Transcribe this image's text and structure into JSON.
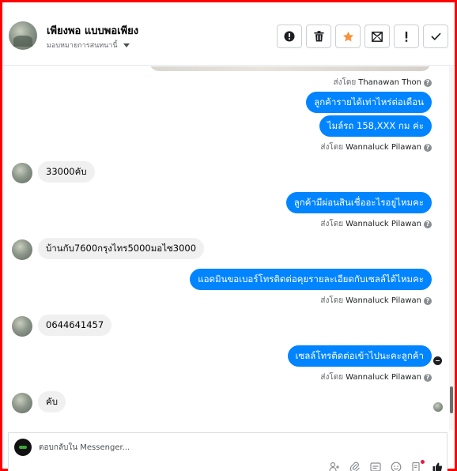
{
  "header": {
    "contact_name": "เพียงพอ แบบพอเพียง",
    "assign_label": "มอบหมายการสนทนานี้",
    "actions": [
      {
        "name": "spam-button",
        "icon": "exclamation-circle-icon"
      },
      {
        "name": "delete-button",
        "icon": "trash-icon"
      },
      {
        "name": "star-button",
        "icon": "star-icon",
        "color": "#f7923b"
      },
      {
        "name": "mark-unread-button",
        "icon": "envelope-icon"
      },
      {
        "name": "follow-up-button",
        "icon": "exclamation-icon"
      },
      {
        "name": "done-button",
        "icon": "checkmark-icon"
      }
    ]
  },
  "messages": [
    {
      "type": "meta",
      "prefix": "ส่งโดย",
      "sender": "Thanawan Thon"
    },
    {
      "type": "out",
      "text": "ลูกค้ารายได้เท่าไหร่ต่อเดือน"
    },
    {
      "type": "out",
      "text": "ไมล์รถ 158,XXX กม  ค่ะ"
    },
    {
      "type": "meta",
      "prefix": "ส่งโดย",
      "sender": "Wannaluck Pilawan"
    },
    {
      "type": "in",
      "text": "33000คับ"
    },
    {
      "type": "out",
      "text": "ลูกค้ามีผ่อนสินเชื่ออะไรอยู่ไหมคะ"
    },
    {
      "type": "meta",
      "prefix": "ส่งโดย",
      "sender": "Wannaluck Pilawan"
    },
    {
      "type": "in",
      "text": "บ้านกับ7600กรุงไทร5000มอไซ3000"
    },
    {
      "type": "out",
      "text": "แอดมินขอเบอร์โทรติดต่อคุยรายละเอียดกับเซลล์ได้ไหมคะ"
    },
    {
      "type": "meta",
      "prefix": "ส่งโดย",
      "sender": "Wannaluck Pilawan"
    },
    {
      "type": "in",
      "text": "0644641457"
    },
    {
      "type": "out",
      "text": "เซลล์โทรติดต่อเข้าไปนะคะลูกค้า"
    },
    {
      "type": "meta",
      "prefix": "ส่งโดย",
      "sender": "Wannaluck Pilawan"
    },
    {
      "type": "in",
      "text": "คับ"
    }
  ],
  "composer": {
    "placeholder": "ตอบกลับใน Messenger..."
  },
  "colors": {
    "outgoing_bubble": "#0084ff",
    "incoming_bubble": "#f0f0f0",
    "frame_border": "#ff0000"
  }
}
